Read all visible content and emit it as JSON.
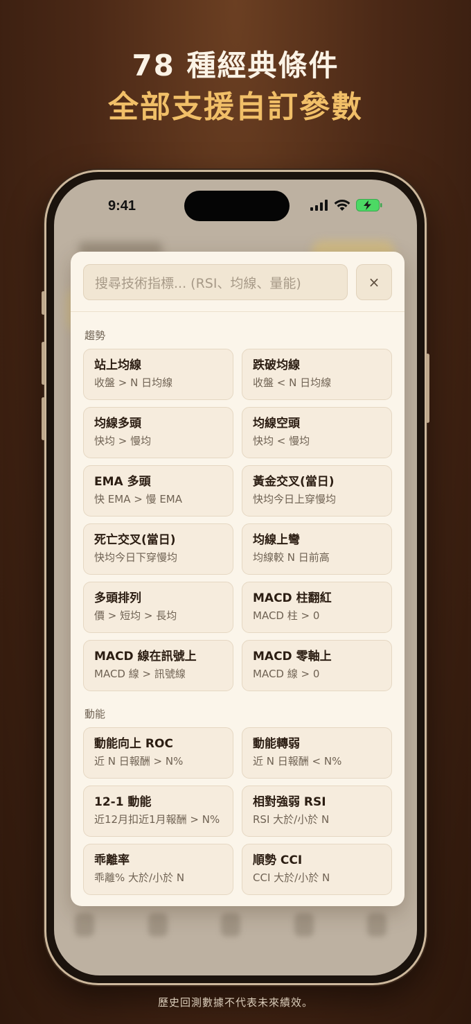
{
  "headline": {
    "line1": "78 種經典條件",
    "line2": "全部支援自訂參數"
  },
  "status_bar": {
    "time": "9:41"
  },
  "search": {
    "placeholder": "搜尋技術指標... (RSI、均線、量能)",
    "close_label": "×"
  },
  "sections": [
    {
      "label": "趨勢",
      "items": [
        {
          "title": "站上均線",
          "desc": "收盤 > N 日均線"
        },
        {
          "title": "跌破均線",
          "desc": "收盤 < N 日均線"
        },
        {
          "title": "均線多頭",
          "desc": "快均 > 慢均"
        },
        {
          "title": "均線空頭",
          "desc": "快均 < 慢均"
        },
        {
          "title": "EMA 多頭",
          "desc": "快 EMA > 慢 EMA"
        },
        {
          "title": "黃金交叉(當日)",
          "desc": "快均今日上穿慢均"
        },
        {
          "title": "死亡交叉(當日)",
          "desc": "快均今日下穿慢均"
        },
        {
          "title": "均線上彎",
          "desc": "均線較 N 日前高"
        },
        {
          "title": "多頭排列",
          "desc": "價 > 短均 > 長均"
        },
        {
          "title": "MACD 柱翻紅",
          "desc": "MACD 柱 > 0"
        },
        {
          "title": "MACD 線在訊號上",
          "desc": "MACD 線 > 訊號線"
        },
        {
          "title": "MACD 零軸上",
          "desc": "MACD 線 > 0"
        }
      ]
    },
    {
      "label": "動能",
      "items": [
        {
          "title": "動能向上 ROC",
          "desc": "近 N 日報酬 > N%"
        },
        {
          "title": "動能轉弱",
          "desc": "近 N 日報酬 < N%"
        },
        {
          "title": "12-1 動能",
          "desc": "近12月扣近1月報酬 > N%"
        },
        {
          "title": "相對強弱 RSI",
          "desc": "RSI 大於/小於 N"
        },
        {
          "title": "乖離率",
          "desc": "乖離% 大於/小於 N"
        },
        {
          "title": "順勢 CCI",
          "desc": "CCI 大於/小於 N"
        }
      ]
    }
  ],
  "footer": {
    "disclaimer": "歷史回測數據不代表未來績效。"
  },
  "colors": {
    "accent": "#f1bf68",
    "sheet_bg": "#fbf5ea",
    "card_bg": "#f6ecdd",
    "battery_green": "#4cd964"
  }
}
